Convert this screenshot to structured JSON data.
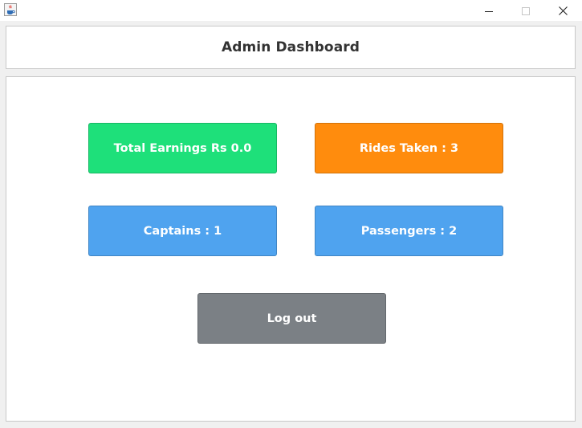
{
  "window": {
    "title": "",
    "icon": "java-cup-icon",
    "controls": {
      "minimize": "minimize-icon",
      "maximize": "maximize-icon",
      "close": "close-icon"
    }
  },
  "header": {
    "title": "Admin Dashboard"
  },
  "dashboard": {
    "total_earnings": {
      "label": "Total Earnings Rs 0.0",
      "color": "#1ee07a"
    },
    "rides_taken": {
      "label": "Rides Taken : 3",
      "color": "#ff8c0d"
    },
    "captains": {
      "label": "Captains : 1",
      "color": "#4fa3ef"
    },
    "passengers": {
      "label": "Passengers : 2",
      "color": "#4fa3ef"
    },
    "logout": {
      "label": "Log out",
      "color": "#7b8085"
    }
  }
}
